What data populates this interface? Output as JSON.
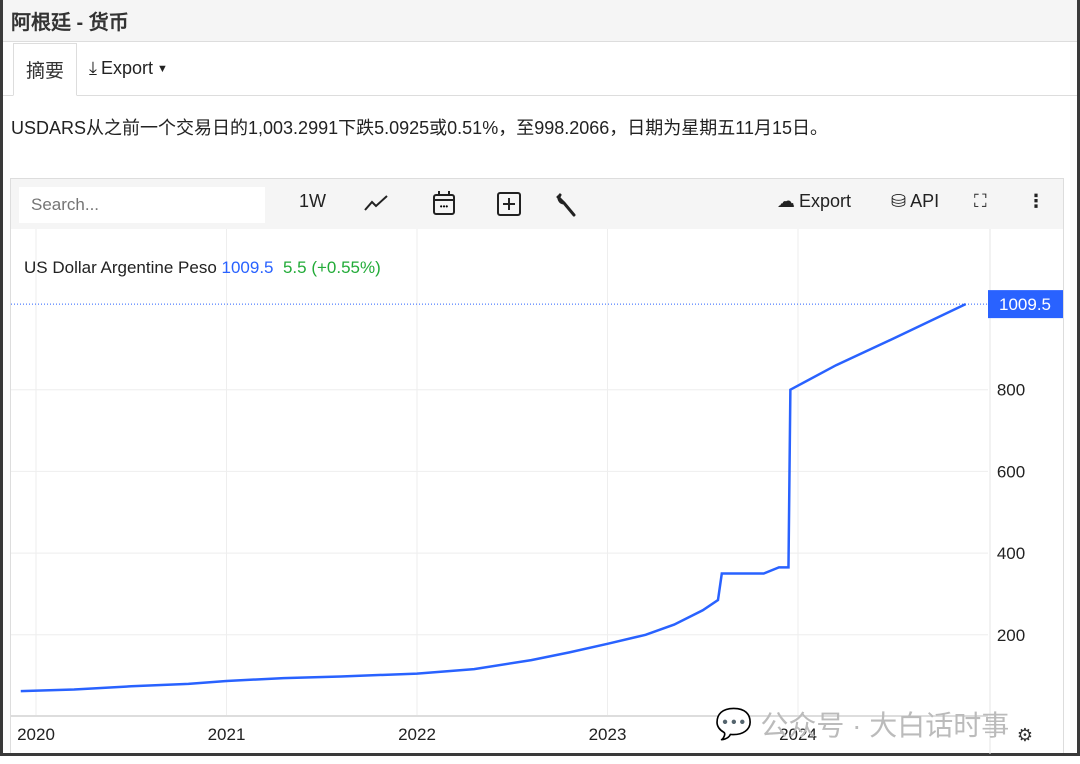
{
  "window": {
    "title": "阿根廷 - 货币"
  },
  "tabs": {
    "summary": "摘要",
    "export": "Export"
  },
  "summary_text": "USDARS从之前一个交易日的1,003.2991下跌5.0925或0.51%，至998.2066，日期为星期五11月15日。",
  "toolbar": {
    "search_placeholder": "Search...",
    "period": "1W",
    "export": "Export",
    "api": "API"
  },
  "legend": {
    "name": "US Dollar Argentine Peso",
    "value": "1009.5",
    "change": "5.5 (+0.55%)"
  },
  "colors": {
    "line": "#2962ff",
    "up": "#22ab38",
    "grid": "#eeeeee"
  },
  "watermark": "公众号 · 大白话时事",
  "chart_data": {
    "type": "line",
    "title": "US Dollar Argentine Peso",
    "x_tick_labels": [
      "2020",
      "2021",
      "2022",
      "2023",
      "2024"
    ],
    "y_tick_labels": [
      "200",
      "400",
      "600",
      "800"
    ],
    "ylim": [
      0,
      1010
    ],
    "xlim": [
      2019.92,
      2025.0
    ],
    "last_value_label": "1009.5",
    "series": [
      {
        "name": "USDARS",
        "points": [
          [
            2019.92,
            62
          ],
          [
            2020.2,
            66
          ],
          [
            2020.5,
            74
          ],
          [
            2020.8,
            80
          ],
          [
            2021.0,
            87
          ],
          [
            2021.3,
            94
          ],
          [
            2021.6,
            98
          ],
          [
            2022.0,
            105
          ],
          [
            2022.3,
            116
          ],
          [
            2022.6,
            138
          ],
          [
            2022.8,
            157
          ],
          [
            2023.0,
            178
          ],
          [
            2023.2,
            200
          ],
          [
            2023.35,
            225
          ],
          [
            2023.5,
            260
          ],
          [
            2023.58,
            285
          ],
          [
            2023.6,
            350
          ],
          [
            2023.82,
            350
          ],
          [
            2023.9,
            365
          ],
          [
            2023.95,
            365
          ],
          [
            2023.96,
            800
          ],
          [
            2024.2,
            860
          ],
          [
            2024.5,
            925
          ],
          [
            2024.88,
            1009.5
          ]
        ]
      }
    ],
    "grid": true
  }
}
